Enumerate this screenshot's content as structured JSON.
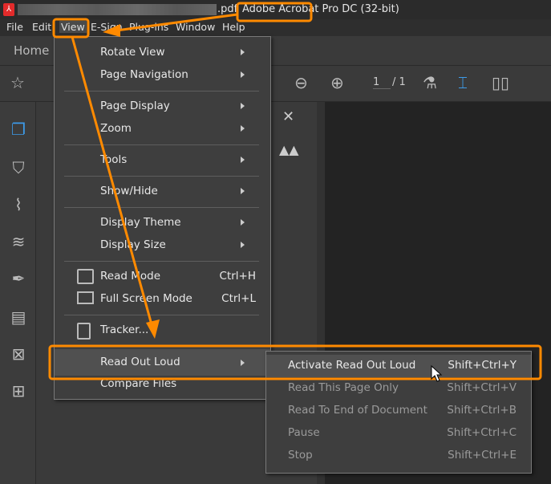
{
  "titlebar": {
    "filename_suffix": ".pdf",
    "app_name": "Adobe Acrobat Pro DC (32-bit)"
  },
  "menubar": [
    "File",
    "Edit",
    "View",
    "E-Sign",
    "Plug-ins",
    "Window",
    "Help"
  ],
  "tabs": {
    "home": "Home"
  },
  "toolbar": {
    "page_current": "1",
    "page_total": "/ 1"
  },
  "view_menu": [
    {
      "label": "Rotate View",
      "submenu": true
    },
    {
      "label": "Page Navigation",
      "submenu": true
    },
    {
      "label": "Page Display",
      "submenu": true
    },
    {
      "label": "Zoom",
      "submenu": true
    },
    {
      "label": "Tools",
      "submenu": true
    },
    {
      "label": "Show/Hide",
      "submenu": true
    },
    {
      "label": "Display Theme",
      "submenu": true
    },
    {
      "label": "Display Size",
      "submenu": true
    },
    {
      "label": "Read Mode",
      "shortcut": "Ctrl+H",
      "icon": "read-mode-icon"
    },
    {
      "label": "Full Screen Mode",
      "shortcut": "Ctrl+L",
      "icon": "monitor-icon"
    },
    {
      "label": "Tracker...",
      "icon": "tracker-icon"
    },
    {
      "label": "Read Out Loud",
      "submenu": true,
      "highlighted": true
    },
    {
      "label": "Compare Files"
    }
  ],
  "read_out_loud_menu": [
    {
      "label": "Activate Read Out Loud",
      "shortcut": "Shift+Ctrl+Y",
      "enabled": true,
      "highlighted": true
    },
    {
      "label": "Read This Page Only",
      "shortcut": "Shift+Ctrl+V",
      "enabled": false
    },
    {
      "label": "Read To End of Document",
      "shortcut": "Shift+Ctrl+B",
      "enabled": false
    },
    {
      "label": "Pause",
      "shortcut": "Shift+Ctrl+C",
      "enabled": false
    },
    {
      "label": "Stop",
      "shortcut": "Shift+Ctrl+E",
      "enabled": false
    }
  ],
  "colors": {
    "annotation": "#ff8a00",
    "accent": "#3d9be9"
  }
}
